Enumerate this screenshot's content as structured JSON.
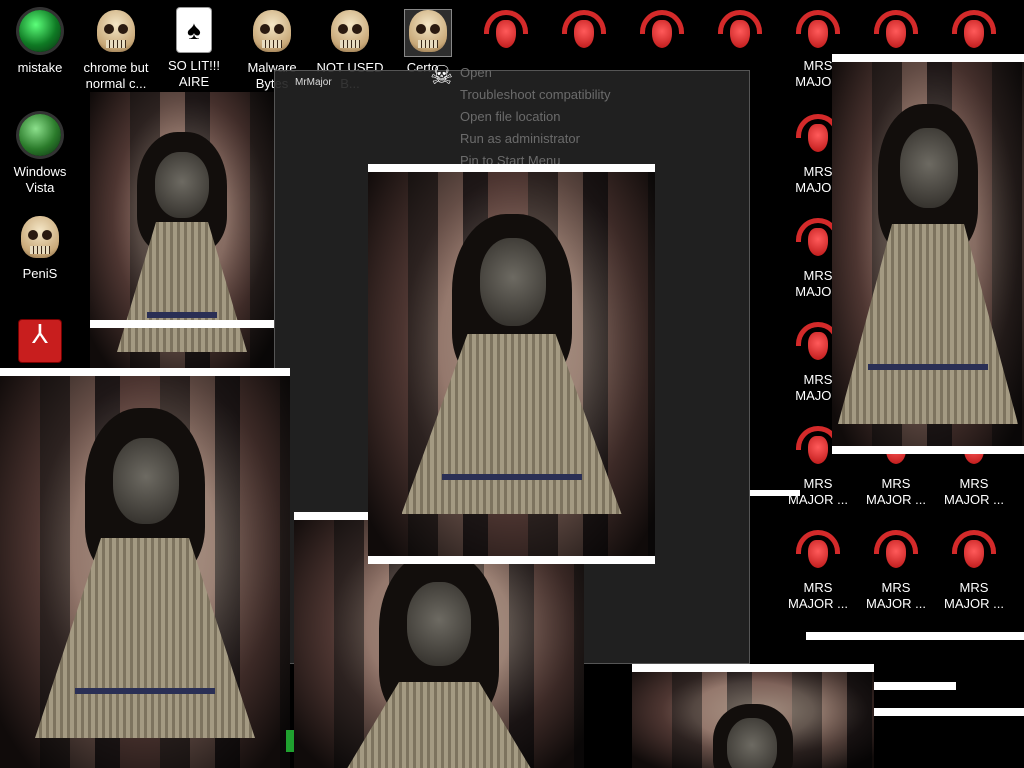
{
  "desktop_icons": [
    {
      "label": "mistake",
      "art": "orb"
    },
    {
      "label": "chrome but normal c...",
      "art": "skull"
    },
    {
      "label": "SO LIT!!! AIRE",
      "art": "card"
    },
    {
      "label": "Malware Bytes",
      "art": "skull"
    },
    {
      "label": "NOT USED B...",
      "art": "skull"
    },
    {
      "label": "Certo...",
      "art": "skull"
    },
    {
      "label": "Windows Vista",
      "art": "orb-recycle"
    },
    {
      "label": "PeniS",
      "art": "skull"
    },
    {
      "label": "",
      "art": "pdf"
    }
  ],
  "demon_icon_label": "MRS MAJOR ...",
  "demon_icon_label_short": "MRS MAJOR",
  "window": {
    "title": "MrMajor"
  },
  "ghost_menu": [
    "Open",
    "Troubleshoot compatibility",
    "Open file location",
    "Run as administrator",
    "Pin to Start Menu"
  ],
  "glyphs": {
    "crossbones": "☠",
    "card": "♠"
  },
  "colors": {
    "demon_red": "#d42a2a",
    "background": "#000000"
  }
}
